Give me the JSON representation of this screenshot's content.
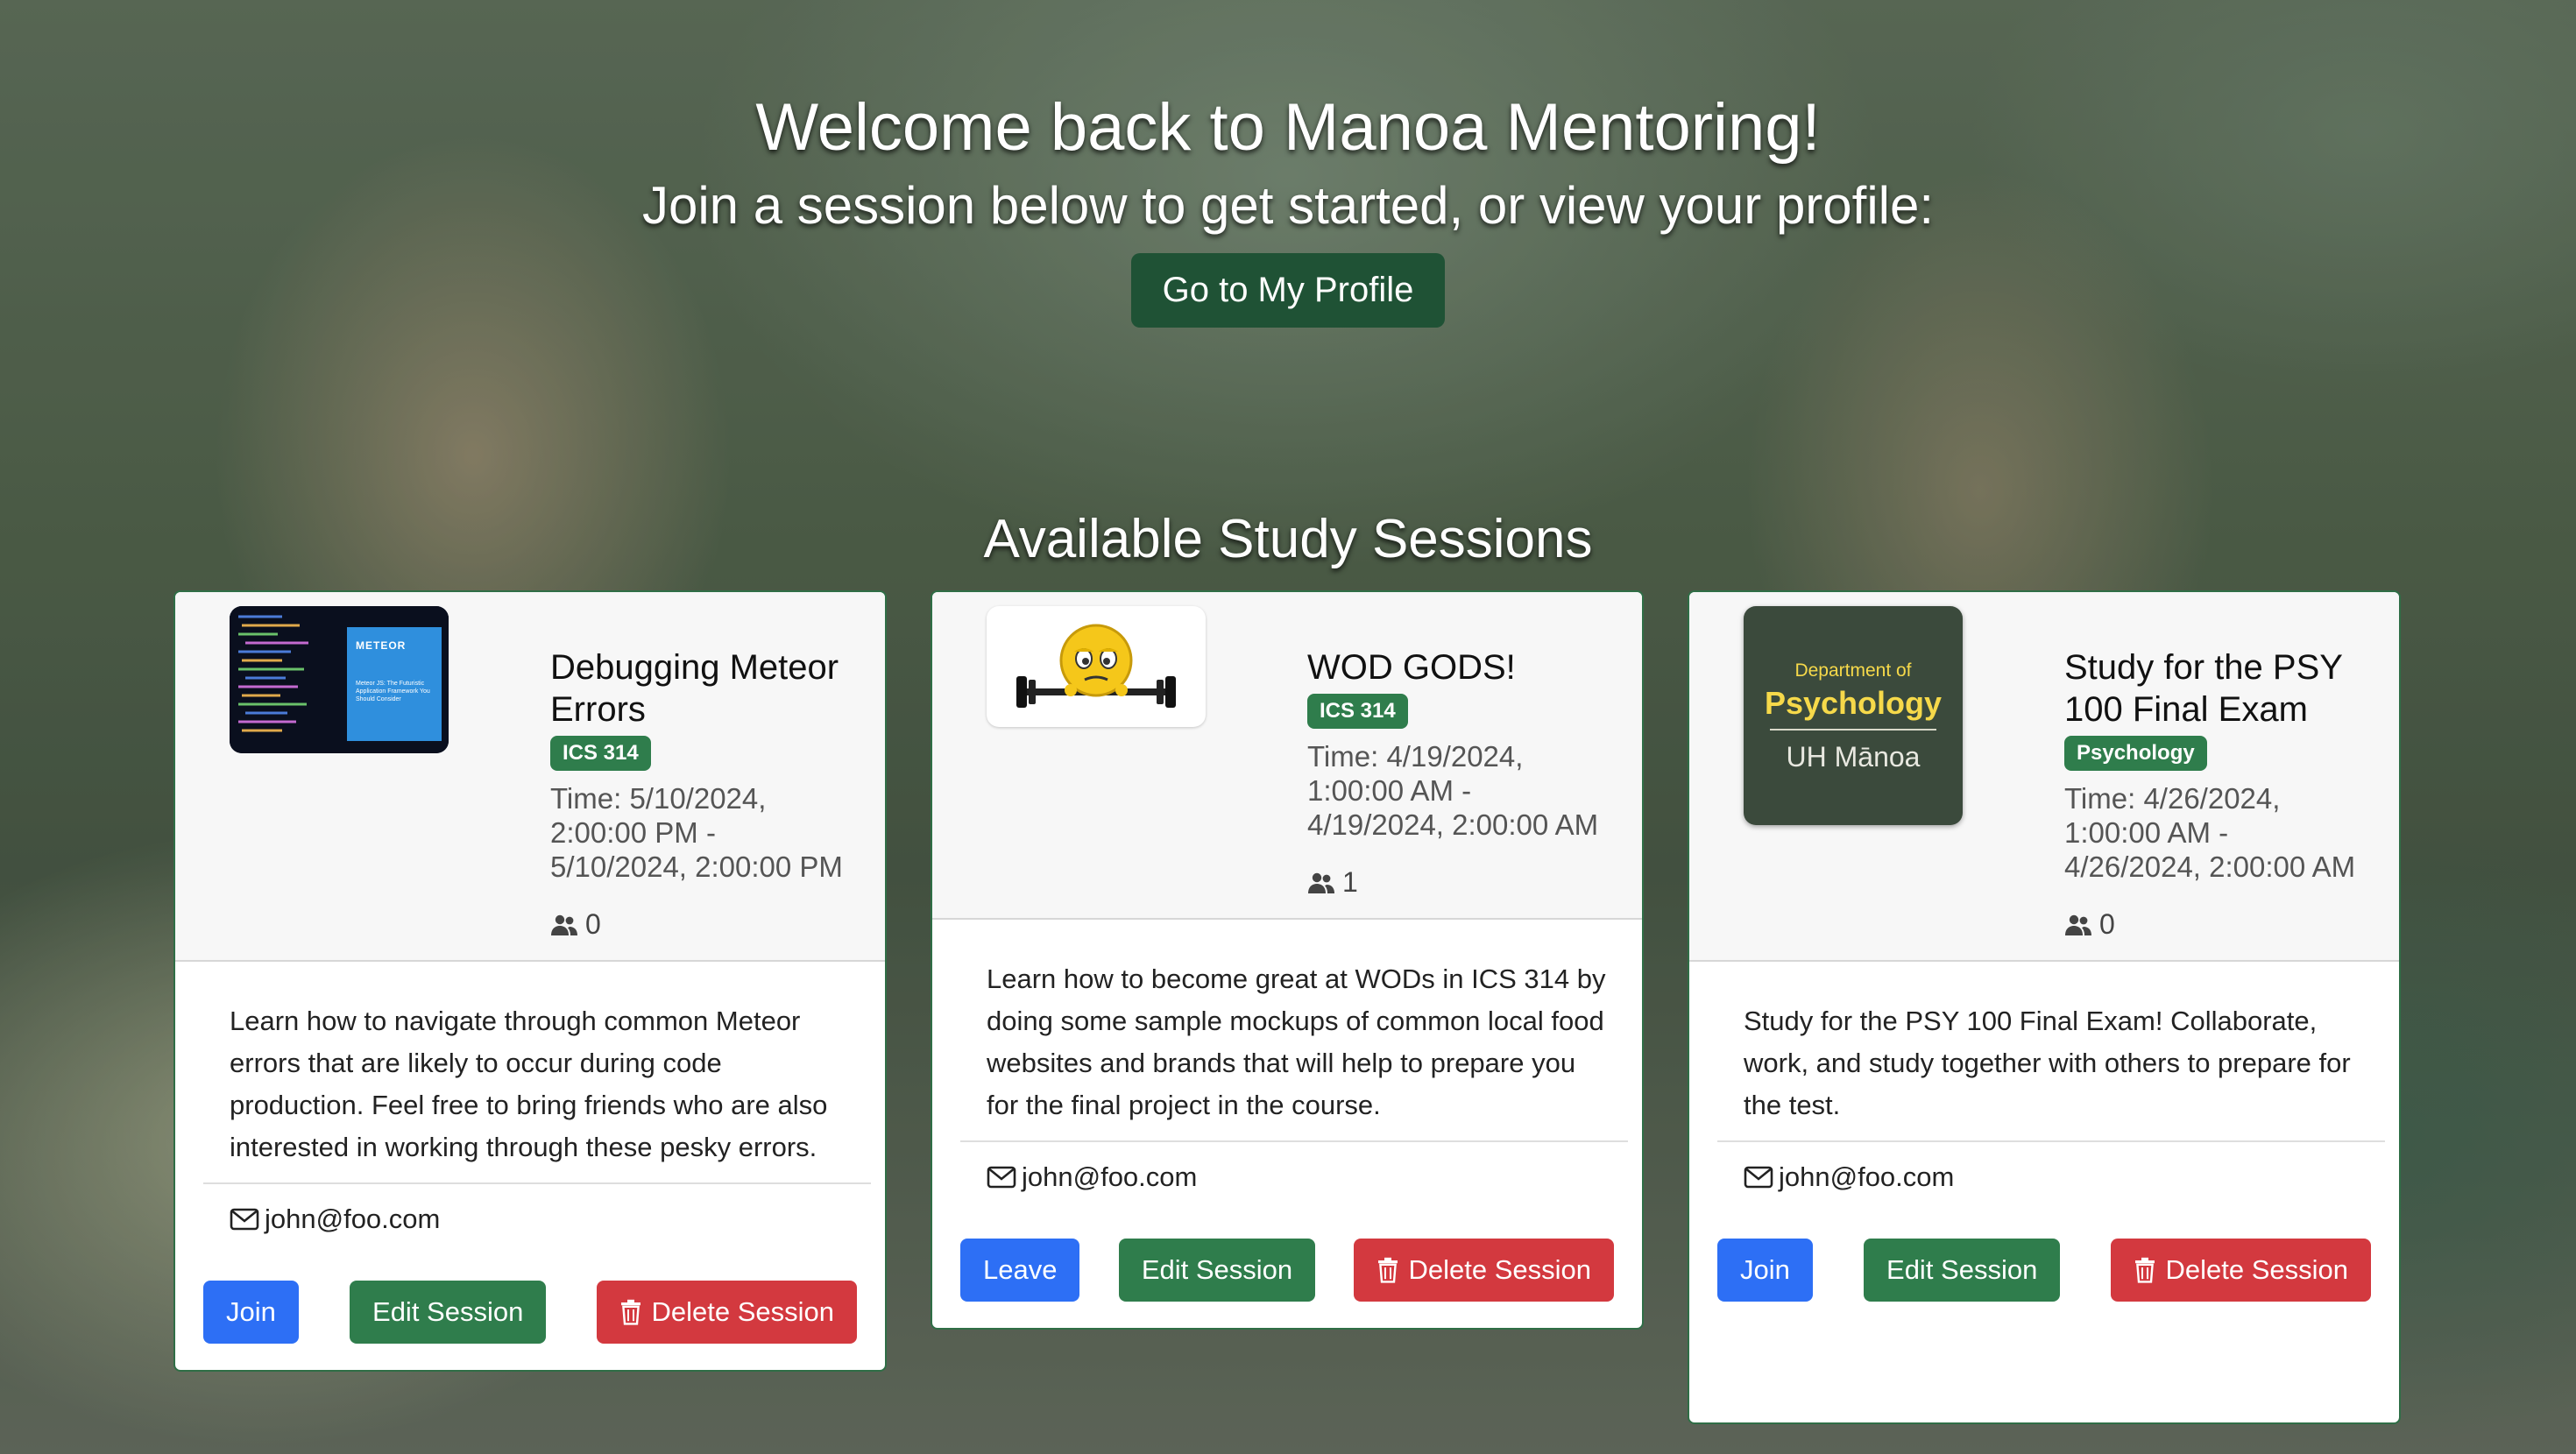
{
  "hero": {
    "title": "Welcome back to Manoa Mentoring!",
    "subtitle": "Join a session below to get started, or view your profile:",
    "profile_button": "Go to My Profile"
  },
  "sessions_title": "Available Study Sessions",
  "cards": [
    {
      "title": "Debugging Meteor Errors",
      "badge": "ICS 314",
      "time": "Time: 5/10/2024, 2:00:00 PM - 5/10/2024, 2:00:00 PM",
      "attendees": "0",
      "description": "Learn how to navigate through common Meteor errors that are likely to occur during code production. Feel free to bring friends who are also interested in working through these pesky errors.",
      "email": "john@foo.com",
      "join_label": "Join",
      "edit_label": "Edit Session",
      "delete_label": "Delete Session",
      "thumb": {
        "brand": "METEOR",
        "caption": "Meteor JS: The Futuristic Application Framework You Should Consider"
      }
    },
    {
      "title": "WOD GODS!",
      "badge": "ICS 314",
      "time": "Time: 4/19/2024, 1:00:00 AM - 4/19/2024, 2:00:00 AM",
      "attendees": "1",
      "description": "Learn how to become great at WODs in ICS 314 by doing some sample mockups of common local food websites and brands that will help to prepare you for the final project in the course.",
      "email": "john@foo.com",
      "join_label": "Leave",
      "edit_label": "Edit Session",
      "delete_label": "Delete Session"
    },
    {
      "title": "Study for the PSY 100 Final Exam",
      "badge": "Psychology",
      "time": "Time: 4/26/2024, 1:00:00 AM - 4/26/2024, 2:00:00 AM",
      "attendees": "0",
      "description": "Study for the PSY 100 Final Exam! Collaborate, work, and study together with others to prepare for the test.",
      "email": "john@foo.com",
      "join_label": "Join",
      "edit_label": "Edit Session",
      "delete_label": "Delete Session",
      "thumb": {
        "line1": "Department of",
        "line2": "Psychology",
        "line3": "UH Mānoa"
      }
    }
  ],
  "colors": {
    "brand_green": "#1f5235",
    "badge_green": "#2f7d4c",
    "primary": "#2d6ff5",
    "danger": "#d3393f"
  }
}
